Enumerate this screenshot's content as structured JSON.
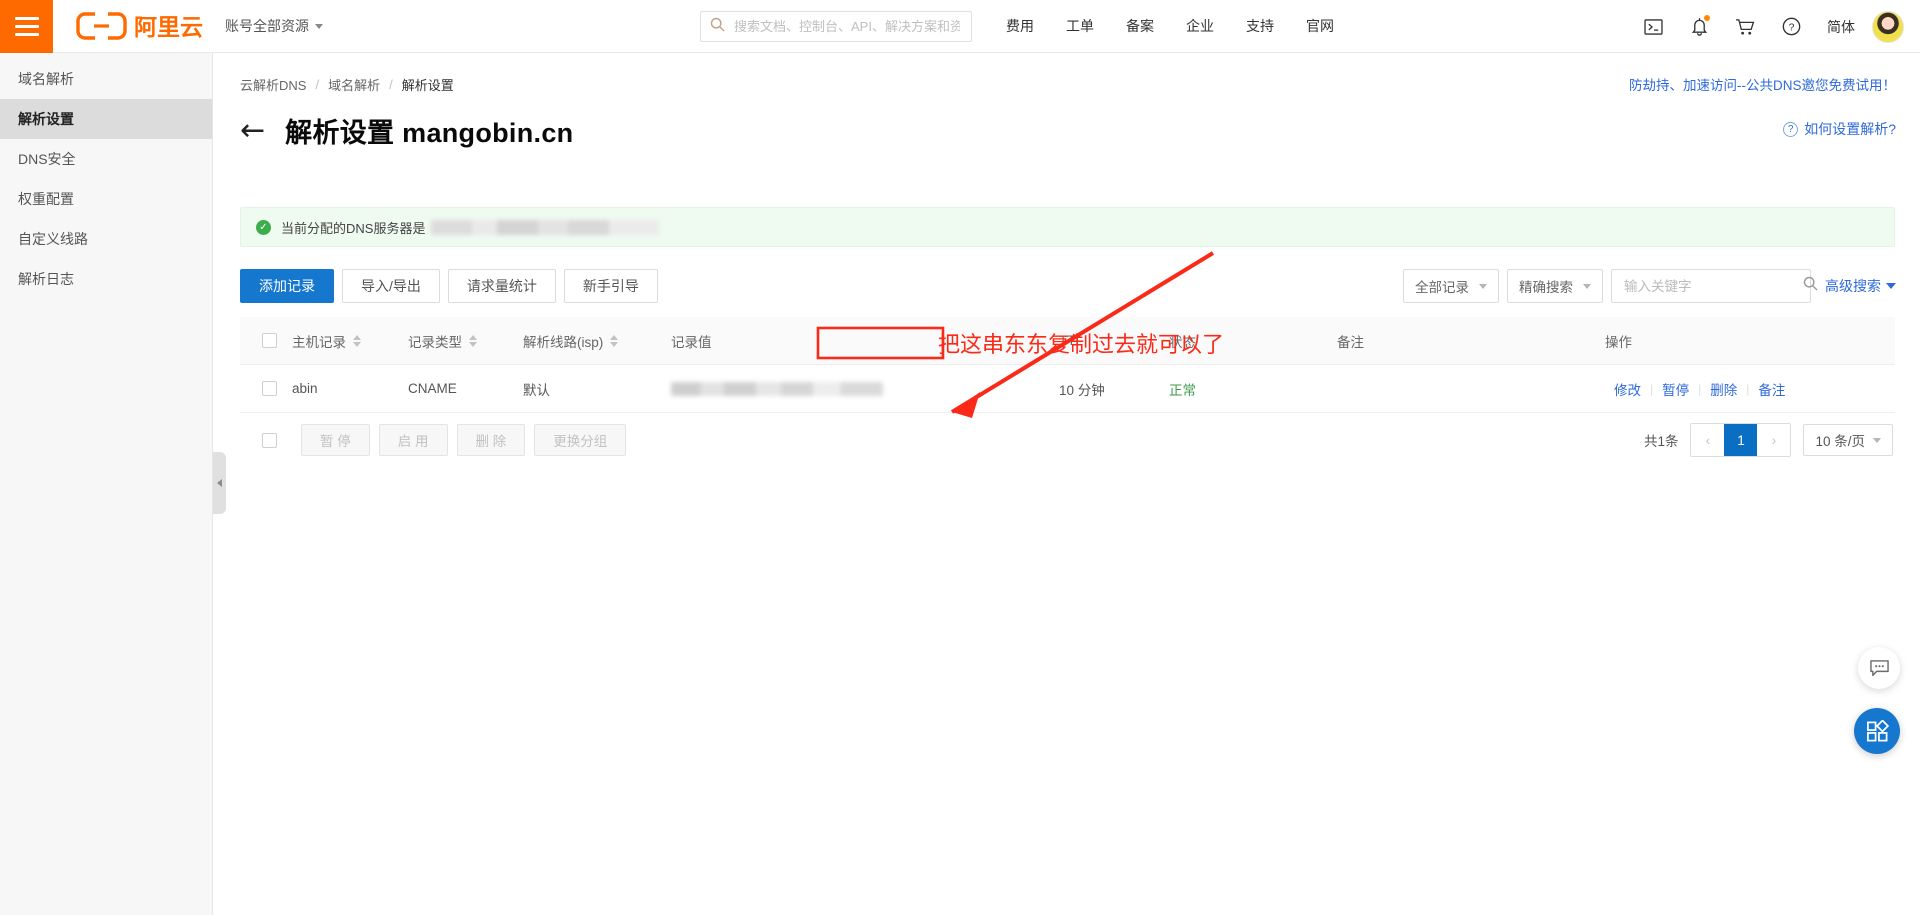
{
  "colors": {
    "brand_orange": "#ff6a00",
    "primary_blue": "#1677cf",
    "link_blue": "#2f6bd8",
    "success_green": "#3c9a4e",
    "annotation_red": "#fb2a18"
  },
  "topbar": {
    "menu_icon": "hamburger-icon",
    "logo_text": "阿里云",
    "account_scope": "账号全部资源",
    "search": {
      "placeholder": "搜索文档、控制台、API、解决方案和资源",
      "value": "",
      "icon": "search-icon"
    },
    "nav": [
      {
        "label": "费用"
      },
      {
        "label": "工单"
      },
      {
        "label": "备案"
      },
      {
        "label": "企业"
      },
      {
        "label": "支持"
      },
      {
        "label": "官网"
      }
    ],
    "icons": [
      {
        "name": "terminal-icon"
      },
      {
        "name": "bell-icon",
        "has_badge": true
      },
      {
        "name": "cart-icon"
      },
      {
        "name": "help-circle-icon"
      }
    ],
    "language": "简体",
    "avatar": "user-avatar"
  },
  "sidebar": {
    "items": [
      {
        "label": "域名解析",
        "active": false
      },
      {
        "label": "解析设置",
        "active": true
      },
      {
        "label": "DNS安全",
        "active": false
      },
      {
        "label": "权重配置",
        "active": false
      },
      {
        "label": "自定义线路",
        "active": false
      },
      {
        "label": "解析日志",
        "active": false
      }
    ]
  },
  "breadcrumb": [
    {
      "label": "云解析DNS"
    },
    {
      "label": "域名解析"
    },
    {
      "label": "解析设置"
    }
  ],
  "header": {
    "back_icon": "back-arrow-icon",
    "title": "解析设置 mangobin.cn",
    "promo_link": "防劫持、加速访问--公共DNS邀您免费试用！",
    "help_link": "如何设置解析?",
    "help_icon": "question-circle-icon"
  },
  "alert": {
    "icon": "check-circle-icon",
    "text": "当前分配的DNS服务器是",
    "redacted_value": ""
  },
  "toolbar": {
    "buttons": [
      {
        "label": "添加记录",
        "style": "primary"
      },
      {
        "label": "导入/导出",
        "style": "default"
      },
      {
        "label": "请求量统计",
        "style": "default"
      },
      {
        "label": "新手引导",
        "style": "default"
      }
    ],
    "record_filter": "全部记录",
    "match_mode": "精确搜索",
    "keyword": {
      "placeholder": "输入关键字",
      "value": "",
      "icon": "search-icon"
    },
    "advanced_search": "高级搜索"
  },
  "table": {
    "columns": [
      {
        "label": "主机记录",
        "sortable": true
      },
      {
        "label": "记录类型",
        "sortable": true
      },
      {
        "label": "解析线路(isp)",
        "sortable": true
      },
      {
        "label": "记录值",
        "sortable": false
      },
      {
        "label": "TTL",
        "sortable": false
      },
      {
        "label": "状态",
        "sortable": false
      },
      {
        "label": "备注",
        "sortable": false
      },
      {
        "label": "操作",
        "sortable": false
      }
    ],
    "rows": [
      {
        "host": "abin",
        "type": "CNAME",
        "line": "默认",
        "value_redacted": "",
        "ttl": "10 分钟",
        "state": "正常",
        "note": "",
        "actions": [
          "修改",
          "暂停",
          "删除",
          "备注"
        ]
      }
    ]
  },
  "footer": {
    "batch_buttons": [
      {
        "label": "暂 停"
      },
      {
        "label": "启 用"
      },
      {
        "label": "删 除"
      },
      {
        "label": "更换分组"
      }
    ],
    "total": "共1条",
    "prev": "‹",
    "page": "1",
    "next": "›",
    "page_size": "10 条/页"
  },
  "floating": {
    "chat": "chat-bubble-icon",
    "apps": "app-grid-icon"
  },
  "annotation": {
    "text": "把这串东东复制过去就可以了",
    "highlight_target": "记录值"
  }
}
